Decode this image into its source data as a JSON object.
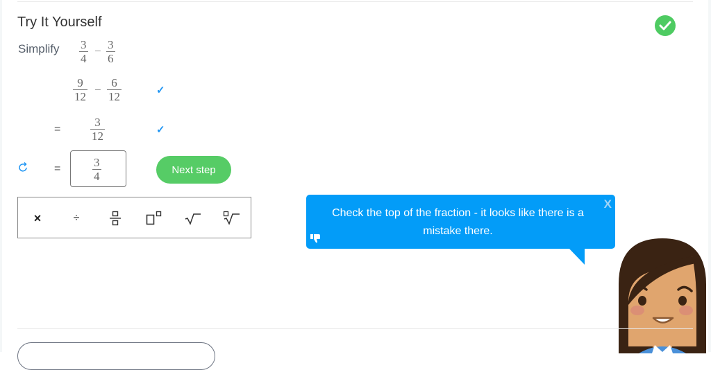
{
  "section": {
    "title": "Try It Yourself",
    "status": "completed"
  },
  "problem": {
    "instruction": "Simplify",
    "expression": {
      "a": {
        "num": "3",
        "den": "4"
      },
      "operator": "−",
      "b": {
        "num": "3",
        "den": "6"
      }
    }
  },
  "steps": [
    {
      "prefix": "",
      "left": {
        "num": "9",
        "den": "12"
      },
      "operator": "−",
      "right": {
        "num": "6",
        "den": "12"
      },
      "check": "✓"
    },
    {
      "prefix": "=",
      "value": {
        "num": "3",
        "den": "12"
      },
      "check": "✓"
    }
  ],
  "current_step": {
    "prefix": "=",
    "input": {
      "num": "3",
      "den": "4"
    },
    "next_button": "Next step"
  },
  "keypad": {
    "keys": [
      {
        "name": "multiply",
        "label": "×"
      },
      {
        "name": "divide",
        "label": "÷"
      },
      {
        "name": "fraction",
        "label": "fraction"
      },
      {
        "name": "exponent",
        "label": "power"
      },
      {
        "name": "square-root",
        "label": "sqrt"
      },
      {
        "name": "nth-root",
        "label": "nth root"
      }
    ]
  },
  "hint": {
    "text": "Check the top of the fraction - it looks like there is a mistake there.",
    "close_label": "X"
  },
  "colors": {
    "accent_blue": "#039cf8",
    "success_green": "#56cc66",
    "check_blue": "#2196f3"
  }
}
